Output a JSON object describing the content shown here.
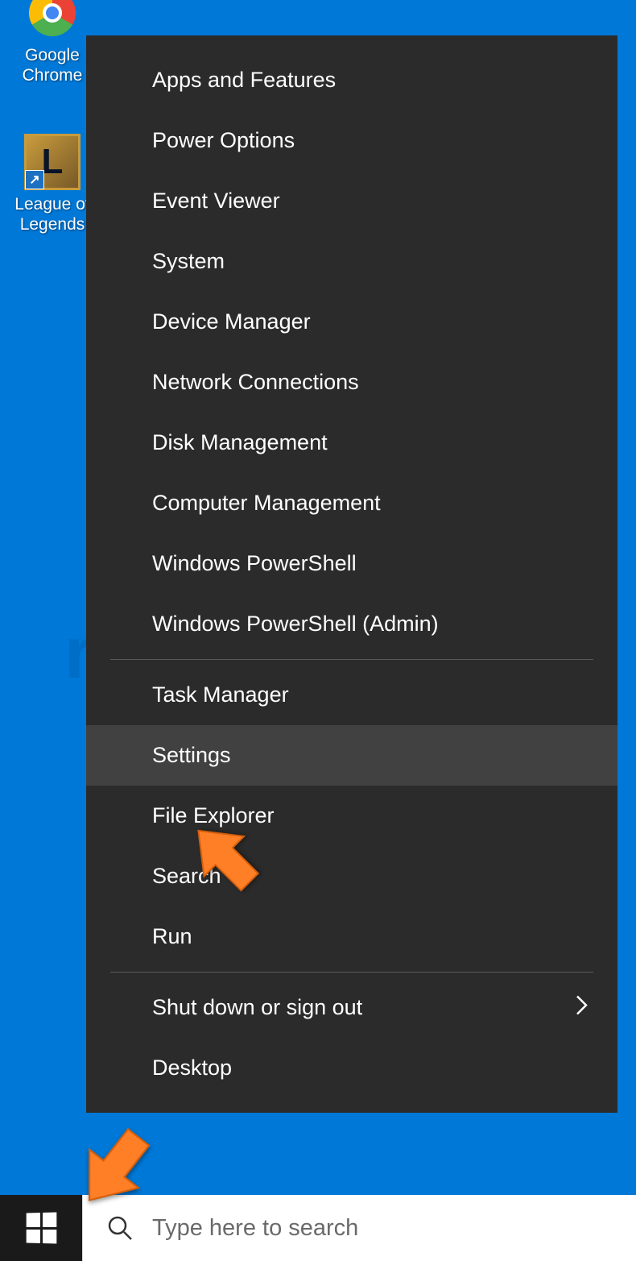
{
  "desktop": {
    "icons": [
      {
        "name": "chrome",
        "label": "Google Chrome"
      },
      {
        "name": "lol",
        "label": "League of Legends",
        "logo_letter": "L"
      }
    ]
  },
  "context_menu": {
    "groups": [
      {
        "items": [
          {
            "id": "apps-features",
            "label": "Apps and Features"
          },
          {
            "id": "power-options",
            "label": "Power Options"
          },
          {
            "id": "event-viewer",
            "label": "Event Viewer"
          },
          {
            "id": "system",
            "label": "System"
          },
          {
            "id": "device-manager",
            "label": "Device Manager"
          },
          {
            "id": "network-connections",
            "label": "Network Connections"
          },
          {
            "id": "disk-management",
            "label": "Disk Management"
          },
          {
            "id": "computer-management",
            "label": "Computer Management"
          },
          {
            "id": "windows-powershell",
            "label": "Windows PowerShell"
          },
          {
            "id": "windows-powershell-admin",
            "label": "Windows PowerShell (Admin)"
          }
        ]
      },
      {
        "items": [
          {
            "id": "task-manager",
            "label": "Task Manager"
          },
          {
            "id": "settings",
            "label": "Settings",
            "highlighted": true
          },
          {
            "id": "file-explorer",
            "label": "File Explorer"
          },
          {
            "id": "search",
            "label": "Search"
          },
          {
            "id": "run",
            "label": "Run"
          }
        ]
      },
      {
        "items": [
          {
            "id": "shut-down",
            "label": "Shut down or sign out",
            "has_submenu": true
          },
          {
            "id": "desktop",
            "label": "Desktop"
          }
        ]
      }
    ]
  },
  "taskbar": {
    "search_placeholder": "Type here to search"
  },
  "annotations": {
    "arrow_color": "#ff7f27"
  }
}
